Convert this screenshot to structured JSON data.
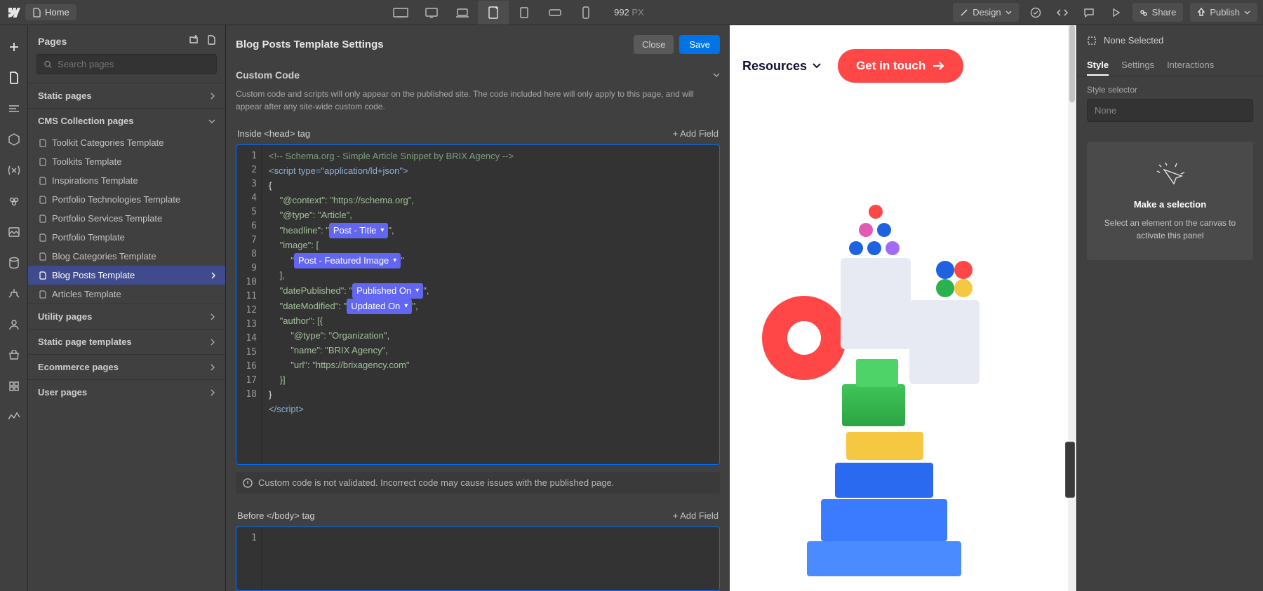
{
  "topbar": {
    "home": "Home",
    "design": "Design",
    "share": "Share",
    "publish": "Publish",
    "px_value": "992",
    "px_unit": "PX"
  },
  "pages": {
    "title": "Pages",
    "search_placeholder": "Search pages",
    "groups": {
      "static": "Static pages",
      "cms": "CMS Collection pages",
      "utility": "Utility pages",
      "spt": "Static page templates",
      "ecom": "Ecommerce pages",
      "user": "User pages"
    },
    "cms_items": [
      "Toolkit Categories Template",
      "Toolkits Template",
      "Inspirations Template",
      "Portfolio Technologies Template",
      "Portfolio Services Template",
      "Portfolio Template",
      "Blog Categories Template",
      "Blog Posts Template",
      "Articles Template"
    ]
  },
  "settings": {
    "title": "Blog Posts Template Settings",
    "close": "Close",
    "save": "Save",
    "cc_title": "Custom Code",
    "cc_desc": "Custom code and scripts will only appear on the published site. The code included here will only apply to this page, and will appear after any site-wide custom code.",
    "head_label": "Inside <head> tag",
    "add_field": "+ Add Field",
    "warn": "Custom code is not validated. Incorrect code may cause issues with the published page.",
    "body_label": "Before </body> tag",
    "code": {
      "comment": "<!-- Schema.org - Simple Article Snippet by BRIX Agency -->",
      "script_open": "<script type=\"application/ld+json\">",
      "open_brace": "{",
      "context_key": "\"@context\": ",
      "context_val": "\"https://schema.org\",",
      "type_key": "\"@type\": ",
      "type_val": "\"Article\",",
      "headline_key": "\"headline\": ",
      "headline_q": "\"",
      "post_title_token": "Post - Title",
      "headline_tail": "\",",
      "image_key": "\"image\": [",
      "img_q": "\"",
      "post_image_token": "Post - Featured Image",
      "img_tail": "\"",
      "image_close": "],",
      "datep_key": "\"datePublished\": ",
      "pub_token": "Published On",
      "datep_tail": "\",",
      "datem_key": "\"dateModified\": ",
      "upd_token": "Updated On",
      "datem_tail": "\",",
      "author_key": "\"author\": [{",
      "auth_type_key": "\"@type\": ",
      "auth_type_val": "\"Organization\",",
      "auth_name_key": "\"name\": ",
      "auth_name_val": "\"BRIX Agency\",",
      "auth_url_key": "\"url\": ",
      "auth_url_val": "\"https://brixagency.com\"",
      "author_close": "}]",
      "close_brace": "}",
      "script_close_text": "script"
    }
  },
  "preview": {
    "resources": "Resources",
    "get_in_touch": "Get in touch"
  },
  "right": {
    "none_selected": "None Selected",
    "tabs": {
      "style": "Style",
      "settings": "Settings",
      "interactions": "Interactions"
    },
    "style_selector_label": "Style selector",
    "none": "None",
    "make_selection": "Make a selection",
    "make_selection_sub": "Select an element on the canvas to activate this panel"
  }
}
